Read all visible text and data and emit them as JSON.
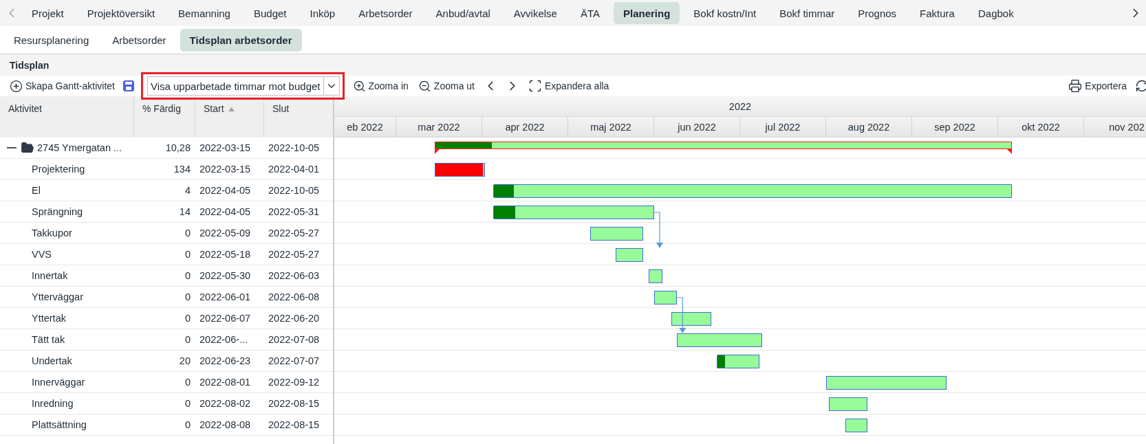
{
  "top_tabs": [
    {
      "label": "Projekt",
      "selected": false
    },
    {
      "label": "Projektöversikt",
      "selected": false
    },
    {
      "label": "Bemanning",
      "selected": false
    },
    {
      "label": "Budget",
      "selected": false
    },
    {
      "label": "Inköp",
      "selected": false
    },
    {
      "label": "Arbetsorder",
      "selected": false
    },
    {
      "label": "Anbud/avtal",
      "selected": false
    },
    {
      "label": "Avvikelse",
      "selected": false
    },
    {
      "label": "ÄTA",
      "selected": false
    },
    {
      "label": "Planering",
      "selected": true
    },
    {
      "label": "Bokf kostn/Int",
      "selected": false
    },
    {
      "label": "Bokf timmar",
      "selected": false
    },
    {
      "label": "Prognos",
      "selected": false
    },
    {
      "label": "Faktura",
      "selected": false
    },
    {
      "label": "Dagbok",
      "selected": false
    }
  ],
  "sub_tabs": [
    {
      "label": "Resursplanering",
      "selected": false
    },
    {
      "label": "Arbetsorder",
      "selected": false
    },
    {
      "label": "Tidsplan arbetsorder",
      "selected": true
    }
  ],
  "panel": {
    "title": "Tidsplan"
  },
  "toolbar": {
    "create": "Skapa Gantt-aktivitet",
    "view_select": {
      "value": "Visa upparbetade timmar mot budget",
      "highlighted": true
    },
    "zoom_in": "Zooma in",
    "zoom_out": "Zooma ut",
    "expand": "Expandera alla",
    "export": "Exportera"
  },
  "grid": {
    "columns": [
      {
        "label": "Aktivitet",
        "sorted_ascending": false
      },
      {
        "label": "% Färdig",
        "sorted_ascending": false
      },
      {
        "label": "Start",
        "sorted_ascending": true
      },
      {
        "label": "Slut",
        "sorted_ascending": false
      }
    ],
    "rows": [
      {
        "kind": "summary",
        "name": "2745 Ymergatan ...",
        "pct": "10,28",
        "start": "2022-03-15",
        "end": "2022-10-05",
        "expanded": true,
        "level": 0.1,
        "overrun": false,
        "link_out": false,
        "children": [
          {
            "kind": "task",
            "name": "Projektering",
            "pct": "134",
            "start": "2022-03-15",
            "end": "2022-04-01",
            "level": 1,
            "overrun": true,
            "link_out": false
          },
          {
            "kind": "task",
            "name": "El",
            "pct": "4",
            "start": "2022-04-05",
            "end": "2022-10-05",
            "level": 0.04,
            "overrun": false,
            "link_out": false
          },
          {
            "kind": "task",
            "name": "Sprängning",
            "pct": "14",
            "start": "2022-04-05",
            "end": "2022-05-31",
            "level": 0.14,
            "overrun": false,
            "link_out": true
          },
          {
            "kind": "task",
            "name": "Takkupor",
            "pct": "0",
            "start": "2022-05-09",
            "end": "2022-05-27",
            "overrun": false,
            "link_out": false
          },
          {
            "kind": "task",
            "name": "VVS",
            "pct": "0",
            "start": "2022-05-18",
            "end": "2022-05-27",
            "overrun": false,
            "link_out": false
          },
          {
            "kind": "task",
            "name": "Innertak",
            "pct": "0",
            "start": "2022-05-30",
            "end": "2022-06-03",
            "overrun": false,
            "link_out": false
          },
          {
            "kind": "task",
            "name": "Ytterväggar",
            "pct": "0",
            "start": "2022-06-01",
            "end": "2022-06-08",
            "overrun": false,
            "link_out": true
          },
          {
            "kind": "task",
            "name": "Yttertak",
            "pct": "0",
            "start": "2022-06-07",
            "end": "2022-06-20",
            "overrun": false,
            "link_out": false
          },
          {
            "kind": "task",
            "name": "Tätt tak",
            "pct": "0",
            "start": "2022-06-...",
            "end": "2022-07-08",
            "overrun": false,
            "link_out": false
          },
          {
            "kind": "task",
            "name": "Undertak",
            "pct": "20",
            "start": "2022-06-23",
            "end": "2022-07-07",
            "level": 0.2,
            "overrun": false,
            "link_out": false
          },
          {
            "kind": "task",
            "name": "Innerväggar",
            "pct": "0",
            "start": "2022-08-01",
            "end": "2022-09-12",
            "overrun": false,
            "link_out": false
          },
          {
            "kind": "task",
            "name": "Inredning",
            "pct": "0",
            "start": "2022-08-02",
            "end": "2022-08-15",
            "overrun": false,
            "link_out": false
          },
          {
            "kind": "task",
            "name": "Plattsättning",
            "pct": "0",
            "start": "2022-08-08",
            "end": "2022-08-15",
            "overrun": false,
            "link_out": false
          }
        ]
      }
    ]
  },
  "timeline": {
    "year": "2022",
    "months": [
      "eb 2022",
      "mar 2022",
      "apr 2022",
      "maj 2022",
      "jun 2022",
      "jul 2022",
      "aug 2022",
      "sep 2022",
      "okt 2022",
      "nov 202"
    ]
  }
}
